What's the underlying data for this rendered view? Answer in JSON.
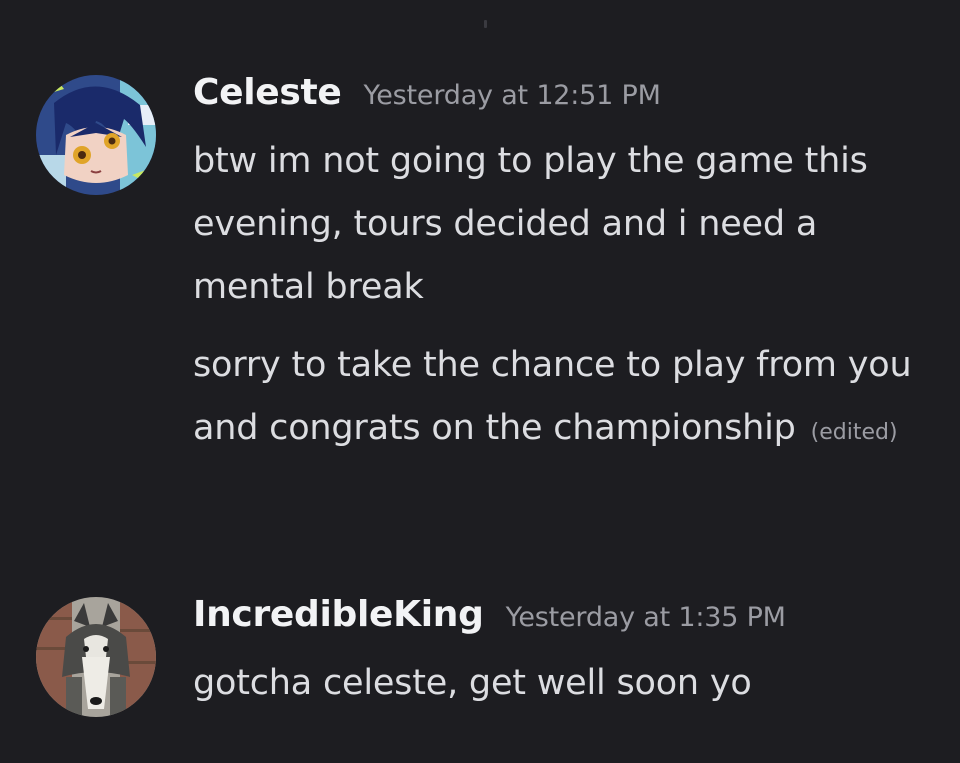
{
  "messages": [
    {
      "author": "Celeste",
      "timestamp": "Yesterday at 12:51 PM",
      "avatar_icon": "anime-character-avatar-icon",
      "paragraphs": [
        "btw im not going to play the game this evening, tours decided and i need a mental break",
        "sorry to take the chance to play from you and congrats on the championship"
      ],
      "edited_label": "(edited)"
    },
    {
      "author": "IncredibleKing",
      "timestamp": "Yesterday at 1:35 PM",
      "avatar_icon": "husky-dog-avatar-icon",
      "paragraphs": [
        "gotcha celeste, get well soon yo"
      ]
    }
  ],
  "colors": {
    "background": "#1d1d21",
    "username": "#f2f3f5",
    "message_text": "#dcdde1",
    "timestamp": "#9b9ca3"
  }
}
